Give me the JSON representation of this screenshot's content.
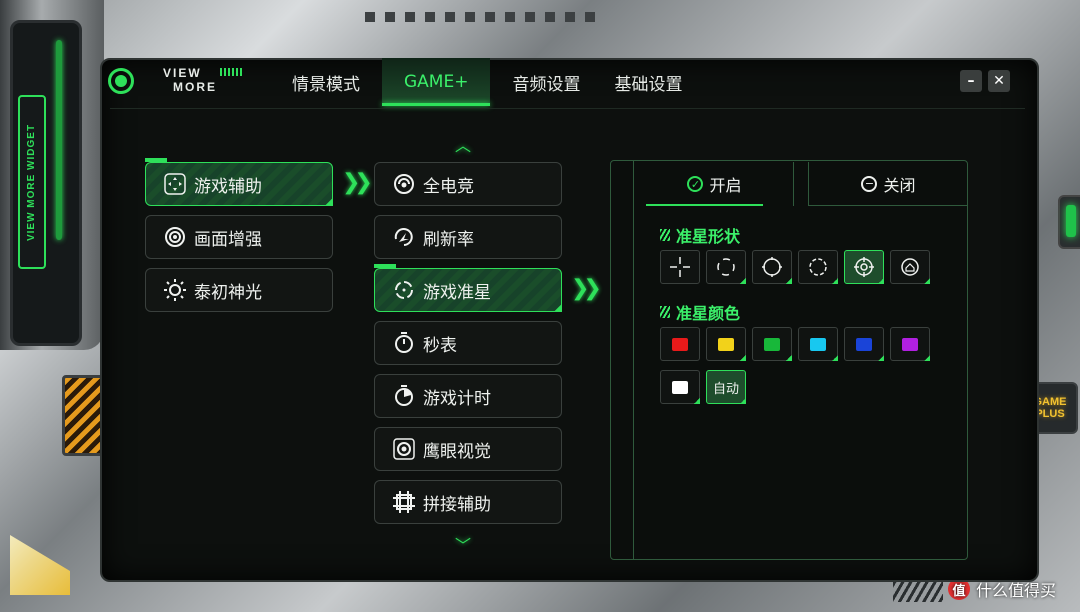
{
  "brand": {
    "line1": "VIEW",
    "line2": "MORE",
    "side_label": "VIEW MORE WIDGET",
    "badge_line1": "GAME",
    "badge_line2": "PLUS"
  },
  "header": {
    "tabs": [
      {
        "label": "情景模式"
      },
      {
        "label": "GAME+",
        "active": true
      },
      {
        "label": "音频设置"
      },
      {
        "label": "基础设置"
      }
    ],
    "minimize_label": "–",
    "close_label": "✕"
  },
  "left_menu": {
    "items": [
      {
        "label": "游戏辅助",
        "icon": "gamepad-icon",
        "active": true
      },
      {
        "label": "画面增强",
        "icon": "display-enhance-icon"
      },
      {
        "label": "泰初神光",
        "icon": "sun-icon"
      }
    ]
  },
  "middle_menu": {
    "items": [
      {
        "label": "全电竞",
        "icon": "esports-icon"
      },
      {
        "label": "刷新率",
        "icon": "refresh-rate-icon"
      },
      {
        "label": "游戏准星",
        "icon": "crosshair-icon",
        "active": true
      },
      {
        "label": "秒表",
        "icon": "stopwatch-icon"
      },
      {
        "label": "游戏计时",
        "icon": "game-timer-icon"
      },
      {
        "label": "鹰眼视觉",
        "icon": "eagle-eye-icon"
      },
      {
        "label": "拼接辅助",
        "icon": "splice-icon"
      }
    ]
  },
  "crosshair_panel": {
    "on_label": "开启",
    "off_label": "关闭",
    "toggle_state": "on",
    "shape_title": "准星形状",
    "shapes": [
      {
        "icon": "plus-crosshair-icon"
      },
      {
        "icon": "corner-bracket-crosshair-icon"
      },
      {
        "icon": "circle-crosshair-icon"
      },
      {
        "icon": "dashed-circle-crosshair-icon"
      },
      {
        "icon": "scope-crosshair-icon",
        "selected": true
      },
      {
        "icon": "house-crosshair-icon"
      }
    ],
    "color_title": "准星颜色",
    "colors": [
      {
        "name": "red",
        "hex": "#e81a1a"
      },
      {
        "name": "yellow",
        "hex": "#f2d21a"
      },
      {
        "name": "green",
        "hex": "#18b83a"
      },
      {
        "name": "cyan",
        "hex": "#18c8f0"
      },
      {
        "name": "blue",
        "hex": "#1a44d8"
      },
      {
        "name": "purple",
        "hex": "#b020e0"
      },
      {
        "name": "white",
        "hex": "#ffffff"
      }
    ],
    "auto_label": "自动",
    "auto_selected": true
  },
  "accent_color": "#2ee05a",
  "watermark": {
    "badge": "值",
    "text": "什么值得买"
  }
}
